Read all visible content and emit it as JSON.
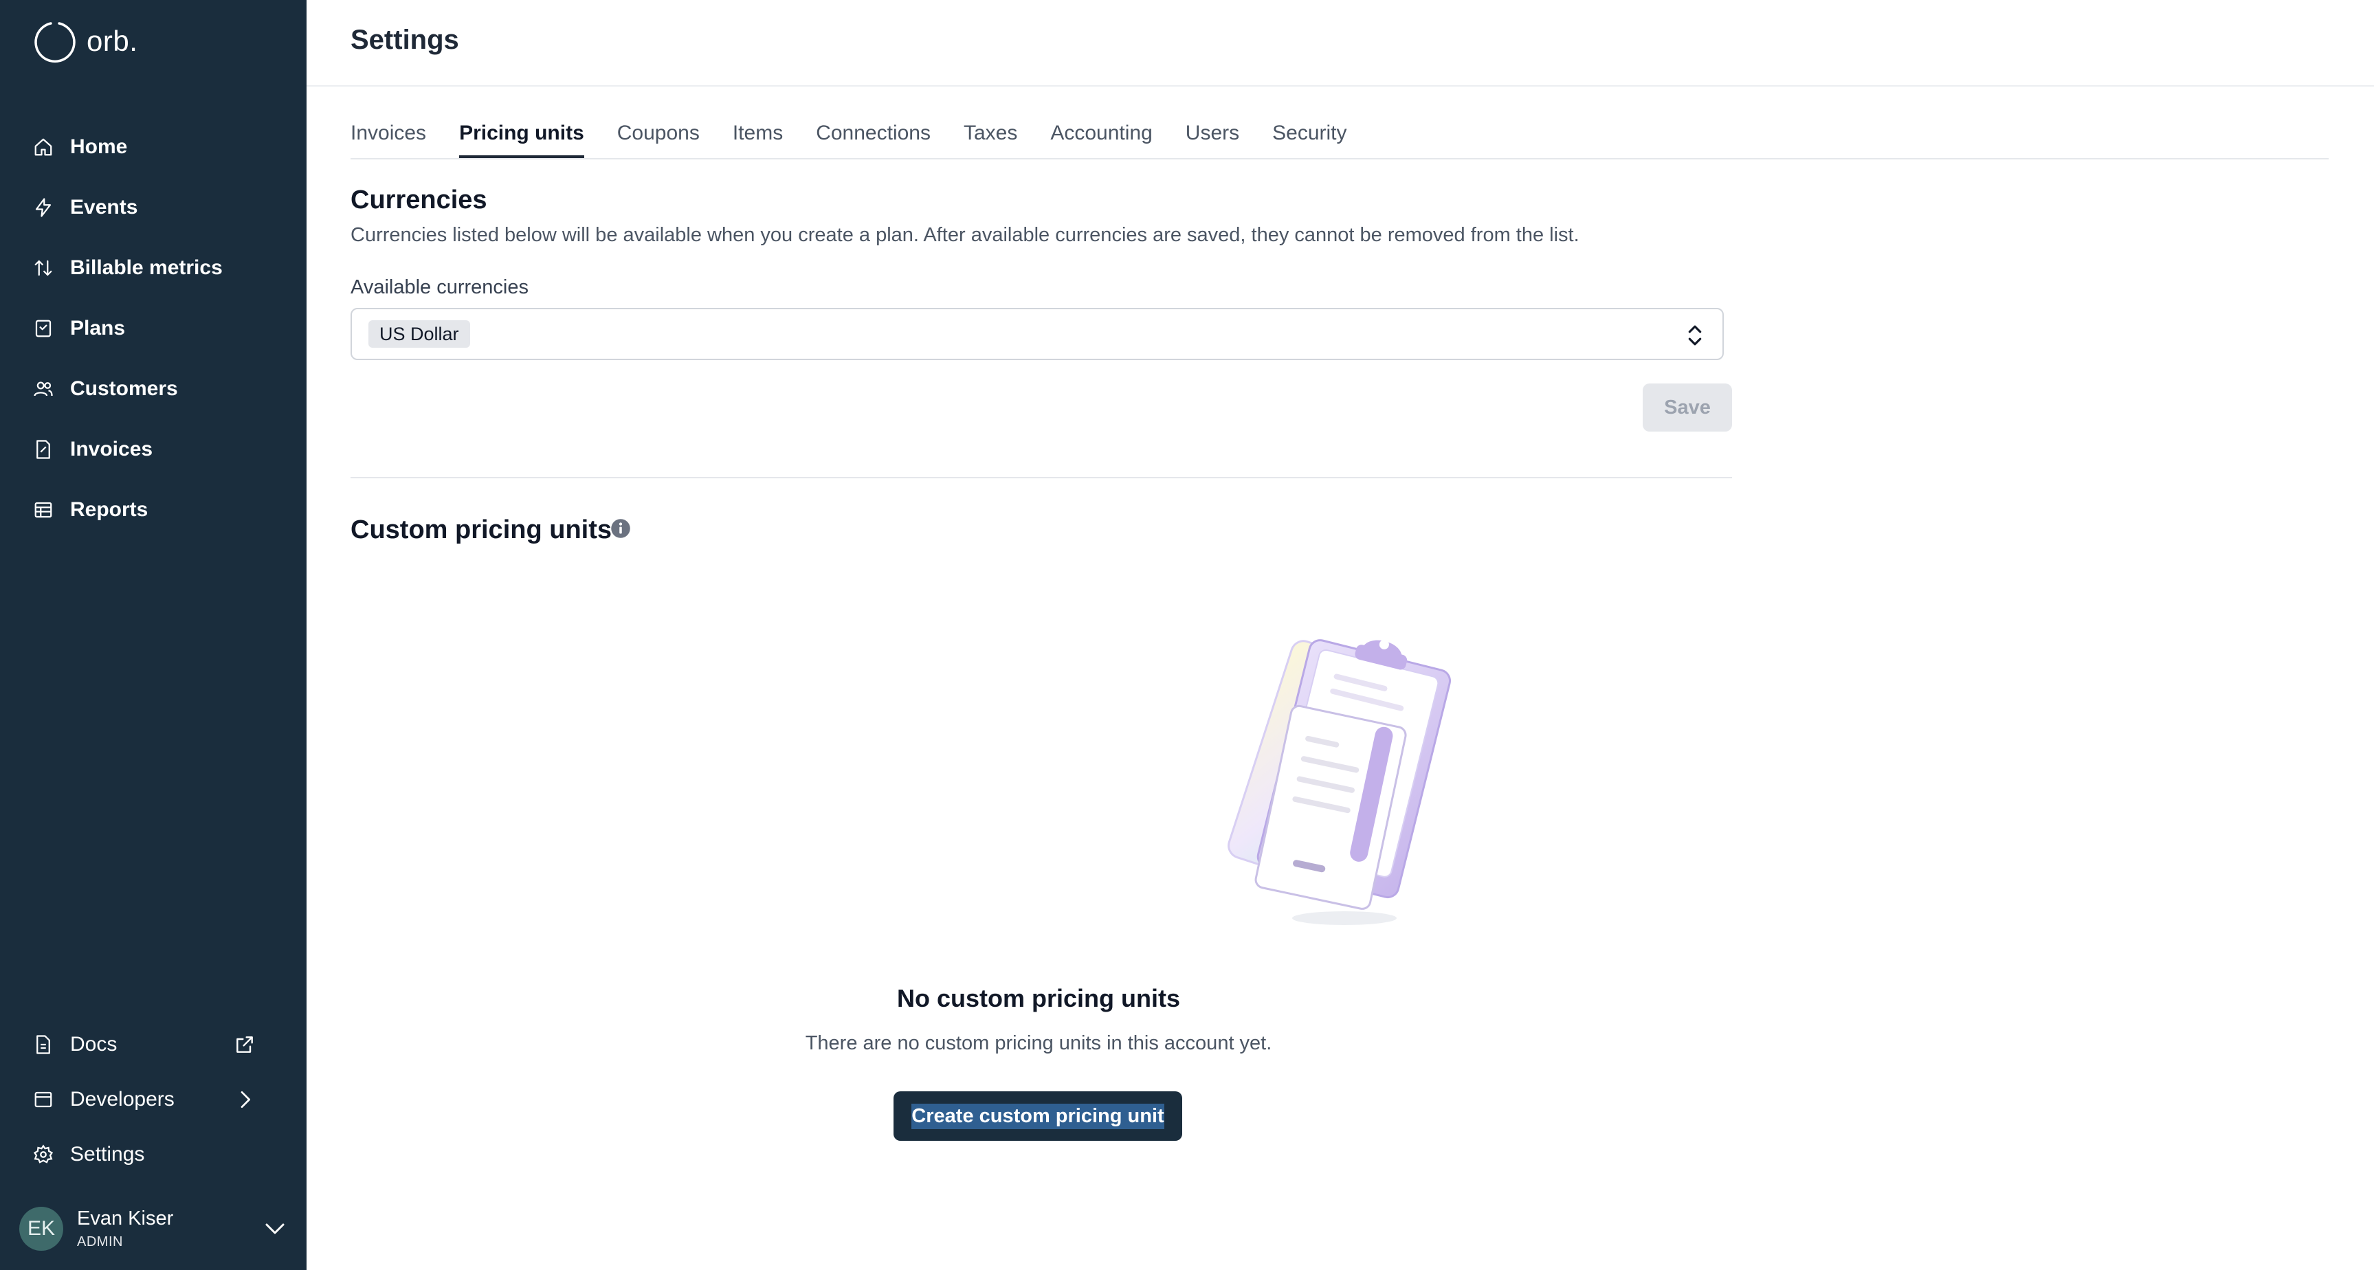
{
  "brand": {
    "logo_text": "orb."
  },
  "sidebar": {
    "items": [
      {
        "label": "Home",
        "icon": "home-icon"
      },
      {
        "label": "Events",
        "icon": "lightning-icon"
      },
      {
        "label": "Billable metrics",
        "icon": "arrows-up-down-icon"
      },
      {
        "label": "Plans",
        "icon": "clipboard-icon"
      },
      {
        "label": "Customers",
        "icon": "users-icon"
      },
      {
        "label": "Invoices",
        "icon": "invoice-icon"
      },
      {
        "label": "Reports",
        "icon": "table-icon"
      }
    ],
    "bottom_items": [
      {
        "label": "Docs",
        "icon": "document-icon",
        "trailing_icon": "external-link-icon"
      },
      {
        "label": "Developers",
        "icon": "window-icon",
        "trailing_icon": "chevron-right-icon"
      },
      {
        "label": "Settings",
        "icon": "gear-icon"
      }
    ],
    "user": {
      "initials": "EK",
      "name": "Evan Kiser",
      "role": "ADMIN"
    }
  },
  "page": {
    "title": "Settings"
  },
  "tabs": [
    {
      "label": "Invoices",
      "active": false
    },
    {
      "label": "Pricing units",
      "active": true
    },
    {
      "label": "Coupons",
      "active": false
    },
    {
      "label": "Items",
      "active": false
    },
    {
      "label": "Connections",
      "active": false
    },
    {
      "label": "Taxes",
      "active": false
    },
    {
      "label": "Accounting",
      "active": false
    },
    {
      "label": "Users",
      "active": false
    },
    {
      "label": "Security",
      "active": false
    }
  ],
  "currencies": {
    "title": "Currencies",
    "description": "Currencies listed below will be available when you create a plan. After available currencies are saved, they cannot be removed from the list.",
    "field_label": "Available currencies",
    "selected": [
      "US Dollar"
    ],
    "save_label": "Save"
  },
  "custom_units": {
    "title": "Custom pricing units",
    "empty_title": "No custom pricing units",
    "empty_subtitle": "There are no custom pricing units in this account yet.",
    "create_label": "Create custom pricing unit"
  },
  "colors": {
    "sidebar_bg": "#1a2d3d",
    "primary_button": "#1a2d3d",
    "text_selection": "#2f5f91",
    "illustration_purple": "#c9b8ea"
  }
}
